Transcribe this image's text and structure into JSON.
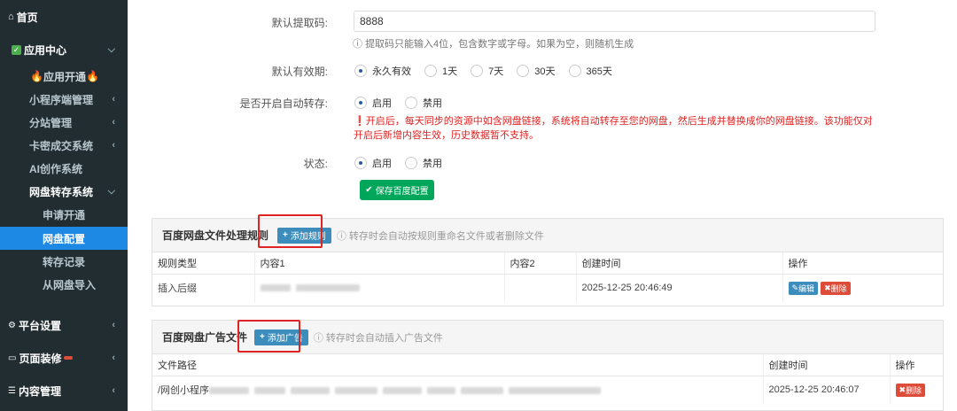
{
  "sidebar": {
    "home": "首页",
    "app_center": "应用中心",
    "app_open": "应用开通",
    "miniapp": "小程序端管理",
    "substation": "分站管理",
    "card_trade": "卡密成交系统",
    "ai_create": "AI创作系统",
    "netdisk": "网盘转存系统",
    "apply": "申请开通",
    "netdisk_config": "网盘配置",
    "transfer_record": "转存记录",
    "import": "从网盘导入",
    "platform": "平台设置",
    "page_decor": "页面装修",
    "content": "内容管理"
  },
  "form": {
    "code_label": "默认提取码:",
    "code_value": "8888",
    "code_help": "提取码只能输入4位，包含数字或字母。如果为空，则随机生成",
    "validity_label": "默认有效期:",
    "validity_options": [
      "永久有效",
      "1天",
      "7天",
      "30天",
      "365天"
    ],
    "auto_label": "是否开启自动转存:",
    "enable": "启用",
    "disable": "禁用",
    "auto_warning": "开启后，每天同步的资源中如含网盘链接，系统将自动转存至您的网盘，然后生成并替换成你的网盘链接。该功能仅对开启后新增内容生效，历史数据暂不支持。",
    "status_label": "状态:",
    "save_button": "保存百度配置"
  },
  "rules": {
    "title": "百度网盘文件处理规则",
    "add_button": "添加规则",
    "tip": "转存时会自动按规则重命名文件或者删除文件",
    "columns": [
      "规则类型",
      "内容1",
      "内容2",
      "创建时间",
      "操作"
    ],
    "row": {
      "type": "插入后缀",
      "content2": "",
      "time": "2025-12-25 20:46:49",
      "edit": "编辑",
      "delete": "删除"
    }
  },
  "ads": {
    "title": "百度网盘广告文件",
    "add_button": "添加广告",
    "tip": "转存时会自动插入广告文件",
    "columns": [
      "文件路径",
      "创建时间",
      "操作"
    ],
    "row": {
      "path": "/网创小程序",
      "time": "2025-12-25 20:46:07",
      "delete": "删除"
    }
  }
}
